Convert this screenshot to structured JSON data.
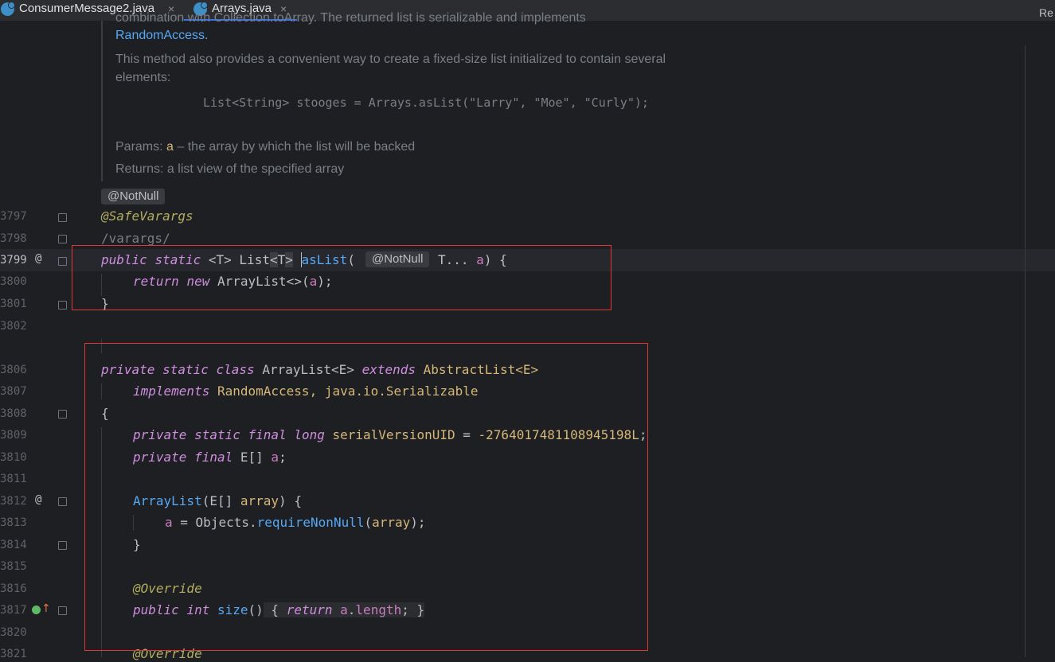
{
  "tabs": [
    {
      "label": "ConsumerMessage2.java",
      "close": "×",
      "active": false
    },
    {
      "label": "Arrays.java",
      "close": "×",
      "active": true
    }
  ],
  "right_panel_label": "Re",
  "doc": {
    "line0": "combination with Collection.toArray. The returned list is serializable and implements",
    "link_randomaccess": "RandomAccess.",
    "para2_line1": "This method also provides a convenient way to create a fixed-size list initialized to contain several",
    "para2_line2": "elements:",
    "example": "List<String> stooges = Arrays.asList(\"Larry\", \"Moe\", \"Curly\");",
    "params_label": "Params:",
    "params_name": "a",
    "params_desc": " – the array by which the list will be backed",
    "returns_label": "Returns:",
    "returns_desc": " a list view of the specified array"
  },
  "badges": {
    "notnull_top": "@NotNull",
    "notnull_inline": "@NotNull"
  },
  "line_numbers": [
    "3797",
    "3798",
    "3799",
    "3800",
    "3801",
    "3802",
    "",
    "3806",
    "3807",
    "3808",
    "3809",
    "3810",
    "3811",
    "3812",
    "3813",
    "3814",
    "3815",
    "3816",
    "3817",
    "3820",
    "3821"
  ],
  "code": {
    "safevarargs": "@SafeVarargs",
    "varargs_comment": "/varargs/",
    "l3799_public": "public",
    "l3799_static": "static",
    "l3799_t": "<T>",
    "l3799_list": "List",
    "l3799_lt": "<",
    "l3799_T": "T",
    "l3799_gt": ">",
    "l3799_aslist": "asList",
    "l3799_paren": "(",
    "l3799_tail": "T... ",
    "l3799_a": "a",
    "l3799_end": ") {",
    "l3800_return": "return",
    "l3800_new": "new",
    "l3800_rest": "ArrayList<>(",
    "l3800_a": "a",
    "l3800_end": ");",
    "l3801": "}",
    "l3806_private": "private",
    "l3806_static": "static",
    "l3806_class": "class",
    "l3806_name": "ArrayList<E>",
    "l3806_extends": "extends",
    "l3806_super": "AbstractList<E>",
    "l3807_implements": "implements",
    "l3807_rest": "RandomAccess, java.io.Serializable",
    "l3808": "{",
    "l3809_private": "private",
    "l3809_static": "static",
    "l3809_final": "final",
    "l3809_long": "long",
    "l3809_name": "serialVersionUID",
    "l3809_eq": " = ",
    "l3809_num": "-2764017481108945198L",
    "l3809_end": ";",
    "l3810_private": "private",
    "l3810_final": "final",
    "l3810_type": "E[] ",
    "l3810_a": "a",
    "l3810_end": ";",
    "l3812_name": "ArrayList",
    "l3812_mid": "(E[] ",
    "l3812_param": "array",
    "l3812_end": ") {",
    "l3813_a": "a",
    "l3813_eq": " = Objects.",
    "l3813_fn": "requireNonNull",
    "l3813_open": "(",
    "l3813_param": "array",
    "l3813_end": ");",
    "l3814": "}",
    "l3816": "@Override",
    "l3817_public": "public",
    "l3817_int": "int",
    "l3817_size": "size",
    "l3817_paren": "()",
    "l3817_open": "{",
    "l3817_return": "return",
    "l3817_a": "a",
    "l3817_dot": ".",
    "l3817_length": "length",
    "l3817_semi": ";",
    "l3817_close": "}",
    "l3821": "@Override"
  },
  "gutter": {
    "at_symbol": "@"
  }
}
